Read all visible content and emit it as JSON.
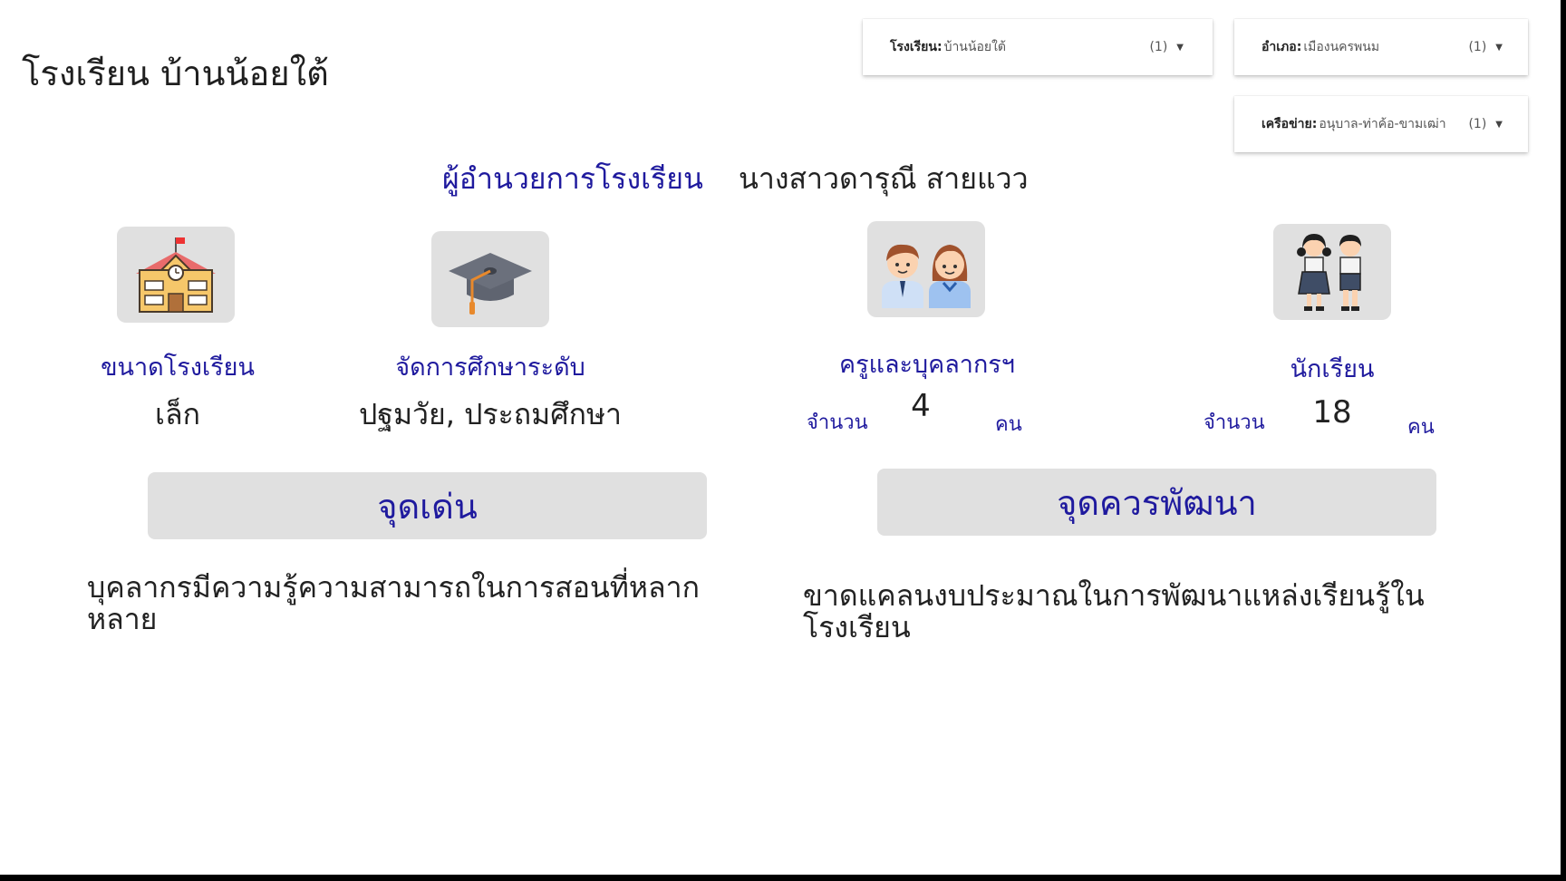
{
  "page": {
    "title": "โรงเรียน บ้านน้อยใต้"
  },
  "filters": [
    {
      "label": "โรงเรียน",
      "value": "บ้านน้อยใต้",
      "count": "(1)"
    },
    {
      "label": "อำเภอ",
      "value": "เมืองนครพนม",
      "count": "(1)"
    },
    {
      "label": "เครือข่าย",
      "value": "อนุบาล-ท่าค้อ-ขามเฒ่า",
      "count": "(1)"
    }
  ],
  "director": {
    "label": "ผู้อำนวยการโรงเรียน",
    "name": "นางสาวดารุณี สายแวว"
  },
  "cards": {
    "size": {
      "icon": "school-building-icon",
      "label": "ขนาดโรงเรียน",
      "value": "เล็ก"
    },
    "level": {
      "icon": "graduation-cap-icon",
      "label": "จัดการศึกษาระดับ",
      "value": "ปฐมวัย, ประถมศึกษา"
    },
    "teachers": {
      "icon": "teachers-icon",
      "label": "ครูและบุคลากรฯ",
      "count_label": "จำนวน",
      "count": "4",
      "unit": "คน"
    },
    "students": {
      "icon": "students-icon",
      "label": "นักเรียน",
      "count_label": "จำนวน",
      "count": "18",
      "unit": "คน"
    }
  },
  "strengths": {
    "heading": "จุดเด่น",
    "text": "บุคลากรมีความรู้ความสามารถในการสอนที่หลากหลาย"
  },
  "improvements": {
    "heading": "จุดควรพัฒนา",
    "text": "ขาดแคลนงบประมาณในการพัฒนาแหล่งเรียนรู้ในโรงเรียน"
  },
  "colors": {
    "accent": "#1f1a9e",
    "panel_bg": "#e0e0e0",
    "frame": "#000000"
  }
}
